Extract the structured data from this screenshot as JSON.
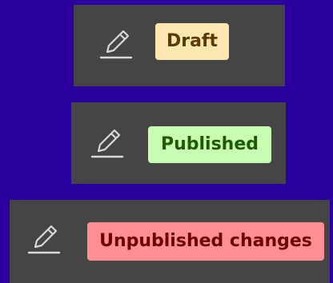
{
  "background_color": "#2a009e",
  "cards": [
    {
      "edit_icon": "pencil-edit-icon",
      "status_label": "Draft",
      "status_color": "#fde7b0",
      "status_text_color": "#5a3a00"
    },
    {
      "edit_icon": "pencil-edit-icon",
      "status_label": "Published",
      "status_color": "#c7ffb3",
      "status_text_color": "#1d5a00"
    },
    {
      "edit_icon": "pencil-edit-icon",
      "status_label": "Unpublished changes",
      "status_color": "#ff8f93",
      "status_text_color": "#6d0007"
    }
  ]
}
